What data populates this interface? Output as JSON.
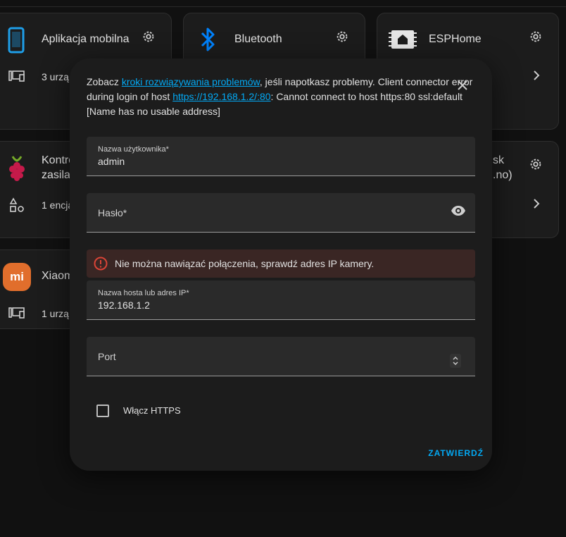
{
  "background_cards": [
    {
      "title": "Aplikacja mobilna",
      "subtitle": "3 urzą"
    },
    {
      "title": "Bluetooth"
    },
    {
      "title": "ESPHome"
    },
    {
      "title_line1": "Kontro",
      "title_line2": "zasila",
      "subtitle": "1 encja"
    },
    {
      "title_line1": "sk",
      "title_line2": ".no)"
    },
    {
      "title": "Xiaom",
      "subtitle": "1 urzą"
    }
  ],
  "dialog": {
    "desc_prefix": "Zobacz ",
    "desc_link1": "kroki rozwiązywania problemów",
    "desc_mid": ", jeśli napotkasz problemy. Client connector error during login of host ",
    "desc_link2": "https://192.168.1.2/:80",
    "desc_suffix": ": Cannot connect to host https:80 ssl:default [Name has no usable address]",
    "username": {
      "label": "Nazwa użytkownika*",
      "value": "admin"
    },
    "password": {
      "label": "Hasło*"
    },
    "error_text": "Nie można nawiązać połączenia, sprawdź adres IP kamery.",
    "host": {
      "label": "Nazwa hosta lub adres IP*",
      "value": "192.168.1.2"
    },
    "port": {
      "label": "Port"
    },
    "https_label": "Włącz HTTPS",
    "submit_label": "ZATWIERDŹ"
  },
  "colors": {
    "accent": "#03a9f4",
    "error": "#db4437",
    "bluetooth": "#0082fc",
    "raspberry": "#c51a4a",
    "xiaomi": "#e16e2c"
  },
  "icons": [
    "phone-icon",
    "bluetooth-icon",
    "esphome-icon",
    "raspberry-icon",
    "xiaomi-icon",
    "devices-icon",
    "entities-icon",
    "gear-icon",
    "chevron-right-icon",
    "close-icon",
    "eye-icon",
    "error-icon",
    "spinner-icon"
  ]
}
